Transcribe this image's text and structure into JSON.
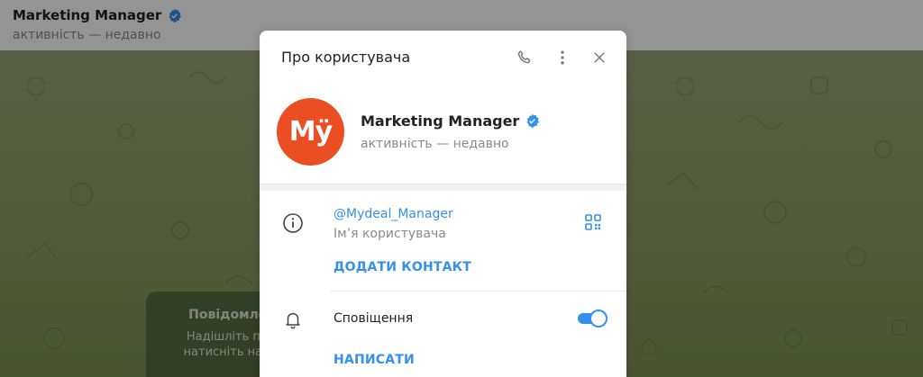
{
  "chat_header": {
    "title": "Marketing Manager",
    "status": "активність — недавно"
  },
  "empty_chat": {
    "heading": "Повідомлень",
    "line1": "Надішліть повід",
    "line2": "натисніть на при"
  },
  "modal": {
    "title": "Про користувача",
    "profile": {
      "avatar_text": "Mÿ",
      "name": "Marketing Manager",
      "status": "активність — недавно"
    },
    "username": "@Mydeal_Manager",
    "username_label": "Ім’я користувача",
    "add_contact": "ДОДАТИ КОНТАКТ",
    "notifications_label": "Сповіщення",
    "notifications_on": true,
    "write": "НАПИСАТИ"
  },
  "icons": {
    "verified": "verified-badge-icon",
    "phone": "phone-icon",
    "more": "more-vertical-icon",
    "close": "close-icon",
    "info": "info-icon",
    "qr": "qr-code-icon",
    "bell": "bell-icon"
  },
  "colors": {
    "accent": "#3390ec",
    "avatar_bg": "#ea4e22",
    "verified": "#3390ec"
  }
}
